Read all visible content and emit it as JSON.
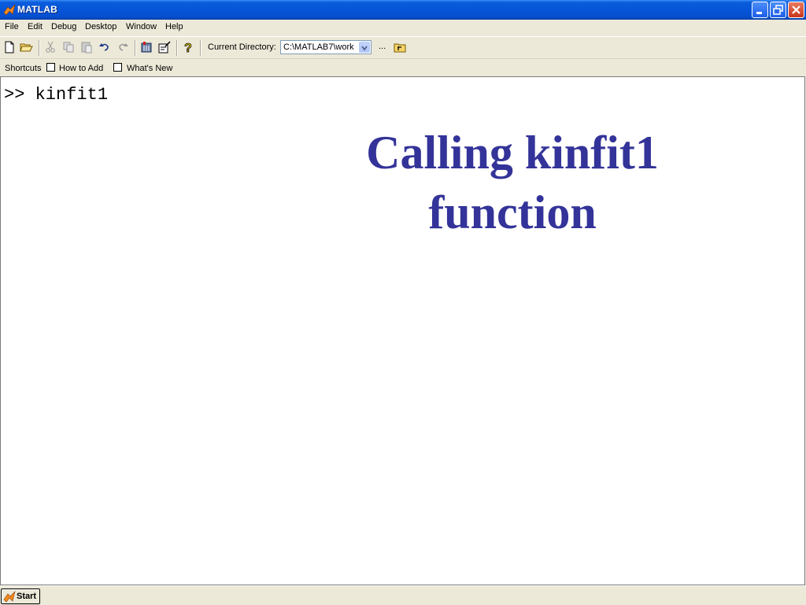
{
  "window": {
    "title": "MATLAB"
  },
  "menu": [
    "File",
    "Edit",
    "Debug",
    "Desktop",
    "Window",
    "Help"
  ],
  "toolbar": {
    "current_directory_label": "Current Directory:",
    "current_directory_value": "C:\\MATLAB7\\work",
    "browse_label": "..."
  },
  "shortcuts": {
    "label": "Shortcuts",
    "items": [
      "How to Add",
      "What's New"
    ]
  },
  "command_window": {
    "prompt": ">>",
    "command": "kinfit1",
    "callout_line1": "Calling kinfit1",
    "callout_line2": "function"
  },
  "statusbar": {
    "start_label": "Start"
  },
  "colors": {
    "callout": "#333399",
    "titlebar": "#0654d8"
  }
}
